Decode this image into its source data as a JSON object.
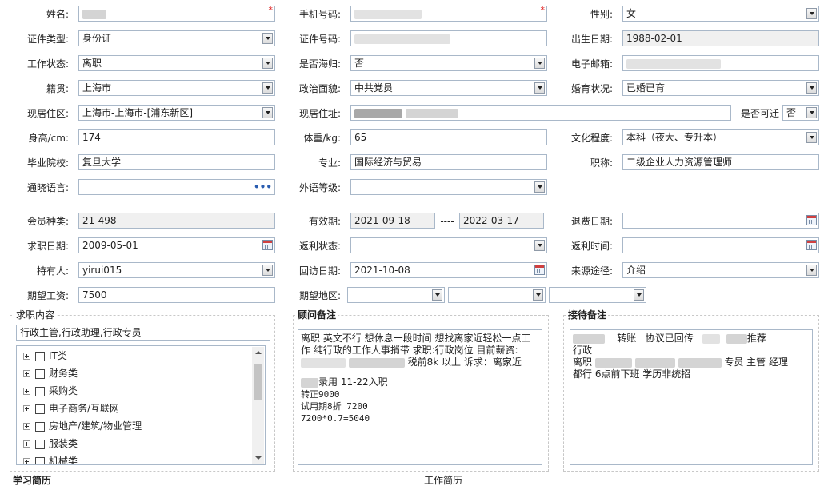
{
  "basic": {
    "name_label": "姓名:",
    "phone_label": "手机号码:",
    "gender_label": "性别:",
    "gender": "女",
    "idtype_label": "证件类型:",
    "idtype": "身份证",
    "idnum_label": "证件号码:",
    "birth_label": "出生日期:",
    "birth": "1988-02-01",
    "workstatus_label": "工作状态:",
    "workstatus": "离职",
    "overseas_label": "是否海归:",
    "overseas": "否",
    "email_label": "电子邮箱:",
    "native_label": "籍贯:",
    "native": "上海市",
    "political_label": "政治面貌:",
    "political": "中共党员",
    "marital_label": "婚育状况:",
    "marital": "已婚已育",
    "resarea_label": "现居住区:",
    "resarea": "上海市-上海市-[浦东新区]",
    "resaddr_label": "现居住址:",
    "relocate_label": "是否可迁",
    "relocate": "否",
    "height_label": "身高/cm:",
    "height": "174",
    "weight_label": "体重/kg:",
    "weight": "65",
    "edu_label": "文化程度:",
    "edu": "本科（夜大、专升本）",
    "school_label": "毕业院校:",
    "school": "复旦大学",
    "major_label": "专业:",
    "major": "国际经济与贸易",
    "title_label": "职称:",
    "title": "二级企业人力资源管理师",
    "lang_label": "通晓语言:",
    "langlevel_label": "外语等级:"
  },
  "member": {
    "type_label": "会员种类:",
    "type": "21-498",
    "valid_label": "有效期:",
    "valid_from": "2021-09-18",
    "valid_sep": "----",
    "valid_to": "2022-03-17",
    "refund_label": "退费日期:",
    "jobdate_label": "求职日期:",
    "jobdate": "2009-05-01",
    "rebate_status_label": "返利状态:",
    "rebate_time_label": "返利时间:",
    "holder_label": "持有人:",
    "holder": "yirui015",
    "visit_label": "回访日期:",
    "visit": "2021-10-08",
    "source_label": "来源途径:",
    "source": "介绍",
    "salary_label": "期望工资:",
    "salary": "7500",
    "region_label": "期望地区:"
  },
  "job": {
    "title": "求职内容",
    "wanted": "行政主管,行政助理,行政专员",
    "categories": [
      "IT类",
      "财务类",
      "采购类",
      "电子商务/互联网",
      "房地产/建筑/物业管理",
      "服装类",
      "机械类"
    ]
  },
  "advisor": {
    "title": "顾问备注",
    "line1": "离职 英文不行 想休息一段时间 想找离家近轻松一点工",
    "line2": "作 纯行政的工作人事捎带 求职:行政岗位 目前薪资:",
    "line3": "税前8k 以上 诉求：离家近",
    "line4": "录用    11-22入职",
    "line5": "转正9000",
    "line6": "试用期8折   7200",
    "line7": "7200*0.7=5040"
  },
  "reception": {
    "title": "接待备注",
    "line1a": "转账",
    "line1b": "协议已回传",
    "line1c": "推荐",
    "line2": "行政",
    "line3a": "离职",
    "line3b": "专员 主管 经理",
    "line4": "都行  6点前下班 学历非统招"
  },
  "bottom": {
    "left": "学习简历",
    "right": "工作简历"
  }
}
